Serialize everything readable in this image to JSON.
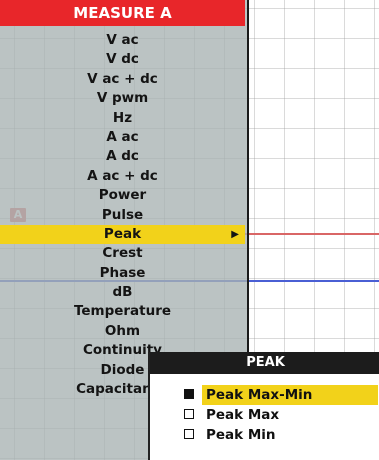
{
  "measure_menu": {
    "title": "MEASURE A",
    "items": [
      {
        "label": "V ac"
      },
      {
        "label": "V dc"
      },
      {
        "label": "V ac + dc"
      },
      {
        "label": "V pwm"
      },
      {
        "label": "Hz"
      },
      {
        "label": "A ac"
      },
      {
        "label": "A dc"
      },
      {
        "label": "A ac + dc"
      },
      {
        "label": "Power"
      },
      {
        "label": "Pulse"
      },
      {
        "label": "Peak",
        "selected": true
      },
      {
        "label": "Crest"
      },
      {
        "label": "Phase"
      },
      {
        "label": "dB"
      },
      {
        "label": "Temperature"
      },
      {
        "label": "Ohm"
      },
      {
        "label": "Continuity"
      },
      {
        "label": "Diode"
      },
      {
        "label": "Capacitance"
      }
    ]
  },
  "peak_panel": {
    "title": "PEAK",
    "options": [
      {
        "label": "Peak Max-Min",
        "checked": true,
        "selected": true
      },
      {
        "label": "Peak Max",
        "checked": false,
        "selected": false
      },
      {
        "label": "Peak Min",
        "checked": false,
        "selected": false
      }
    ]
  },
  "scope": {
    "channel_marker": "A"
  },
  "colors": {
    "menu_title_bg": "#e8262a",
    "highlight": "#f2d21a",
    "trace_red": "#d96666",
    "trace_blue": "#4a5fd4",
    "panel_title_bg": "#1c1c1c"
  }
}
